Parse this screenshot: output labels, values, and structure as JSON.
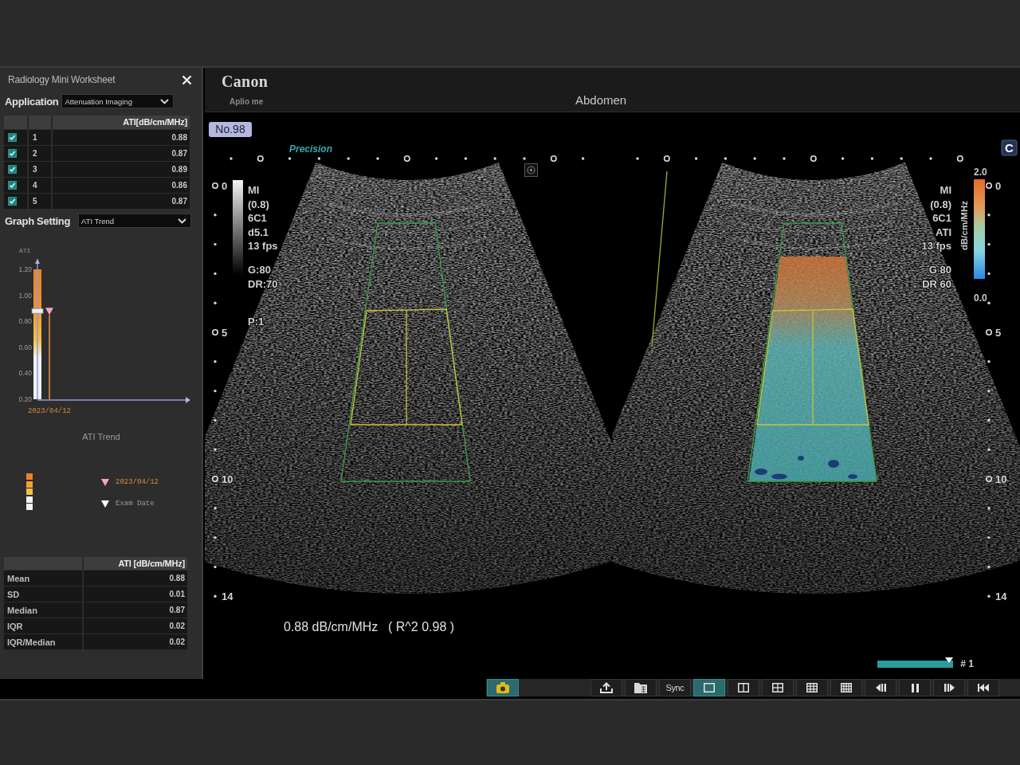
{
  "worksheet": {
    "title": "Radiology Mini Worksheet",
    "application": {
      "label": "Application",
      "value": "Attenuation Imaging"
    },
    "measurements": {
      "value_header": "ATI[dB/cm/MHz]",
      "rows": [
        {
          "checked": true,
          "number": "1",
          "value": "0.88"
        },
        {
          "checked": true,
          "number": "2",
          "value": "0.87"
        },
        {
          "checked": true,
          "number": "3",
          "value": "0.89"
        },
        {
          "checked": true,
          "number": "4",
          "value": "0.86"
        },
        {
          "checked": true,
          "number": "5",
          "value": "0.87"
        }
      ]
    },
    "graph_setting": {
      "label": "Graph Setting",
      "value": "ATI Trend"
    },
    "chart_data": {
      "type": "scatter",
      "title": "ATI Trend",
      "ylabel": "ATI",
      "categories": [
        "2023/04/12"
      ],
      "series": [
        {
          "color": "#f4a3c6",
          "values": [
            0.88
          ]
        }
      ],
      "ylim": [
        0.2,
        1.28
      ],
      "yticks": [
        {
          "value": 0.2,
          "label": "0.20"
        },
        {
          "value": 0.4,
          "label": "0.40"
        },
        {
          "value": 0.6,
          "label": "0.60"
        },
        {
          "value": 0.8,
          "label": "0.80"
        },
        {
          "value": 1.0,
          "label": "1.00"
        },
        {
          "value": 1.2,
          "label": "1.20"
        }
      ]
    },
    "legend": {
      "swatches": [
        {
          "color": "#e8832a"
        },
        {
          "color": "#f2a335"
        },
        {
          "color": "#f5bf45"
        },
        {
          "color": "#f2f2f2"
        },
        {
          "color": "#f2f2f2"
        }
      ],
      "entries": [
        {
          "kind": "current",
          "color": "#f4a3c6",
          "label": "2023/04/12"
        },
        {
          "kind": "exam",
          "color": "#ffffff",
          "label": "Exam Date"
        }
      ]
    },
    "statistics": {
      "header": "ATI [dB/cm/MHz]",
      "rows": [
        {
          "label": "Mean",
          "value": "0.88"
        },
        {
          "label": "SD",
          "value": "0.01"
        },
        {
          "label": "Median",
          "value": "0.87"
        },
        {
          "label": "IQR",
          "value": "0.02"
        },
        {
          "label": "IQR/Median",
          "value": "0.02"
        }
      ]
    }
  },
  "header": {
    "brand": "Canon",
    "model": "Aplio me",
    "exam": "Abdomen"
  },
  "viewer": {
    "study_number": "No.98",
    "preset": "Precision",
    "color_mode": "C",
    "panes": [
      {
        "kind": "bmode",
        "param_groups": [
          {
            "lines": [
              "MI",
              "(0.8)",
              "6C1",
              "d5.1",
              "13 fps"
            ]
          },
          {
            "lines": [
              "G:80",
              "DR:70"
            ]
          },
          {
            "lines": [
              "P:1"
            ]
          }
        ],
        "depth_labels": [
          "0",
          "5",
          "10",
          "14"
        ]
      },
      {
        "kind": "ati",
        "param_groups": [
          {
            "lines": [
              "MI",
              "(0.8)",
              "6C1",
              "ATI",
              "13 fps"
            ]
          },
          {
            "lines": [
              "G 80",
              "DR 60"
            ]
          }
        ],
        "depth_labels": [
          "0",
          "5",
          "10",
          "14"
        ],
        "color_scale": {
          "max": "2.0",
          "min": "0.0",
          "unit": "dB/cm/MHz"
        }
      }
    ],
    "result": "0.88 dB/cm/MHz",
    "fit": "( R^2 0.98 )",
    "cine": {
      "level": 1,
      "frame": "# 1"
    }
  },
  "toolbar": {
    "mode_buttons": [
      {
        "kind": "camera",
        "selected": true
      }
    ],
    "buttons": [
      {
        "kind": "export",
        "selected": false
      },
      {
        "kind": "folder",
        "selected": false
      },
      {
        "kind": "text",
        "label": "Sync",
        "selected": false
      },
      {
        "kind": "single",
        "selected": true
      },
      {
        "kind": "dual",
        "selected": false
      },
      {
        "kind": "quad",
        "selected": false
      },
      {
        "kind": "grid9",
        "selected": false
      },
      {
        "kind": "grid12",
        "selected": false
      },
      {
        "kind": "prev",
        "selected": false
      },
      {
        "kind": "pause",
        "selected": false
      },
      {
        "kind": "next",
        "selected": false
      },
      {
        "kind": "first",
        "selected": false
      }
    ]
  }
}
